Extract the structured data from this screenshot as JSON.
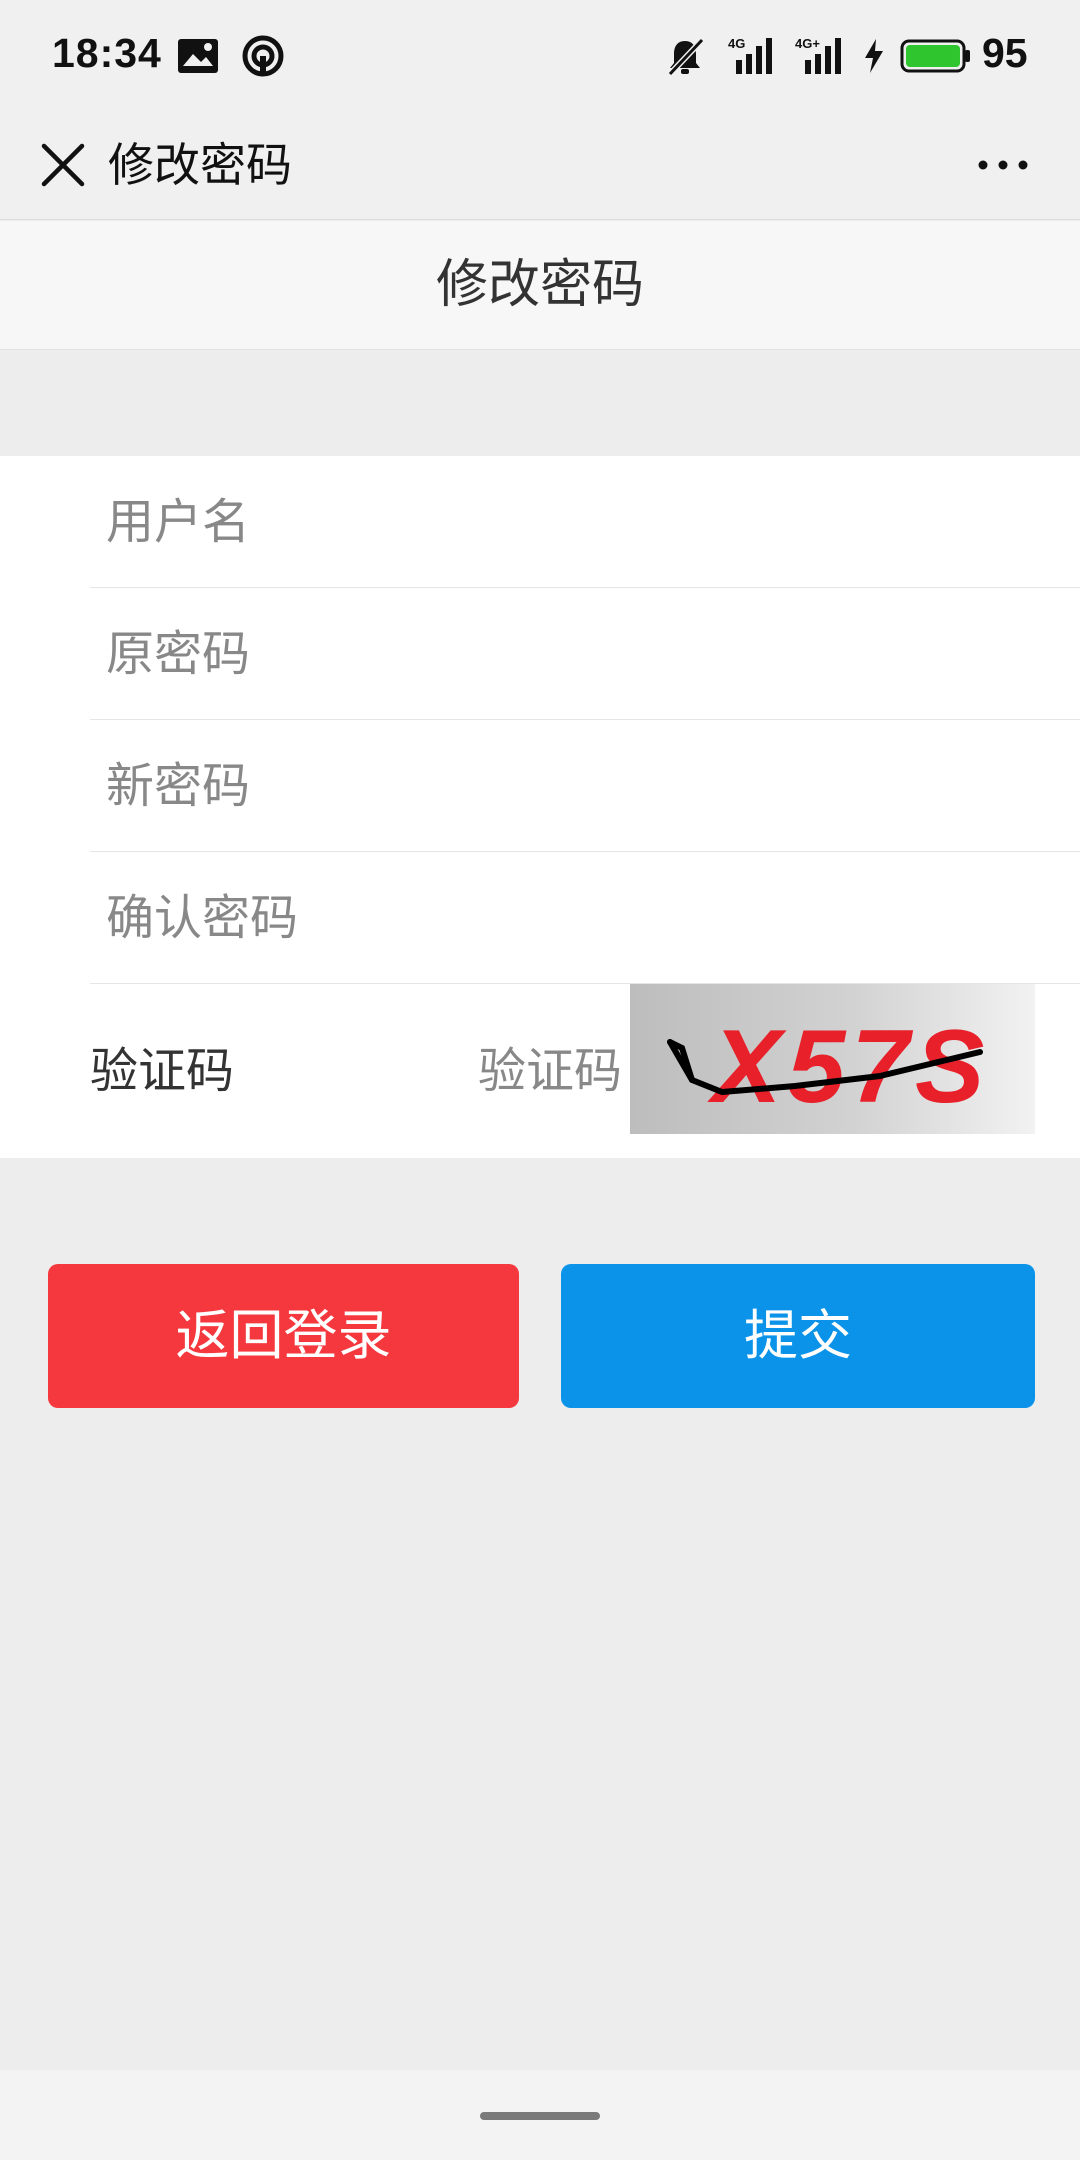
{
  "status_bar": {
    "time": "18:34",
    "battery_percent": "95",
    "battery_color": "#2fc52f",
    "icons": [
      "image-icon",
      "hotspot-icon",
      "mute-bell-icon",
      "signal-4g-icon",
      "signal-4g-plus-icon",
      "charging-icon",
      "battery-icon"
    ]
  },
  "title_bar": {
    "title": "修改密码",
    "close_icon": "close-icon",
    "more_icon": "more-dots-icon"
  },
  "page": {
    "header": "修改密码"
  },
  "form": {
    "username_placeholder": "用户名",
    "old_password_placeholder": "原密码",
    "new_password_placeholder": "新密码",
    "confirm_password_placeholder": "确认密码",
    "captcha_label": "验证码",
    "captcha_placeholder": "验证码",
    "captcha_text": "X57S"
  },
  "buttons": {
    "back_label": "返回登录",
    "back_color": "#f5383d",
    "submit_label": "提交",
    "submit_color": "#0b93e9"
  }
}
